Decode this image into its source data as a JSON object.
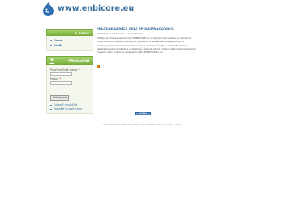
{
  "header": {
    "site_title": "www.enbicore.eu"
  },
  "sidebar": {
    "nav": {
      "heading": "O FIRME",
      "items": [
        {
          "label": "Úvod"
        },
        {
          "label": "Profil"
        }
      ]
    },
    "login": {
      "heading": "PŘIHLÁŠENÍ",
      "username_label": "Používateľské meno:",
      "password_label": "Heslo:",
      "submit_label": "Prihlásenie",
      "links": [
        {
          "label": "Vytvoriť nový účet"
        },
        {
          "label": "Požiadať o nové heslo"
        }
      ]
    }
  },
  "main": {
    "title": "MILÍ ZÁKAZNÍCI, MILÍ SPOLUPRACOVNÍCI",
    "meta": "Posted By: 21/10/2009 - 19:10 admin",
    "body": "Vitajte na stránke spoločnosti ENBICORE s.r.o. Spoločnosť vznikla so zámerom poskytovať komplexné služby pri výstavbe a prevádzke energetických a priemyselných zariadení na Slovensku a v zahraničí. Pre našich zákazníkov zabezpečujeme kvalitné a spoľahlivé riešenie, ktoré zodpovedá ich požiadavkám. Prajeme Vám príjemnú a úspešnú deň. ENBICORE s.r.o."
  },
  "badge": {
    "label": "Drupal"
  },
  "footer": {
    "text": "Téma dizajnu  Drupal Site  |  Web Project Design Studio | Drupal Theme"
  }
}
